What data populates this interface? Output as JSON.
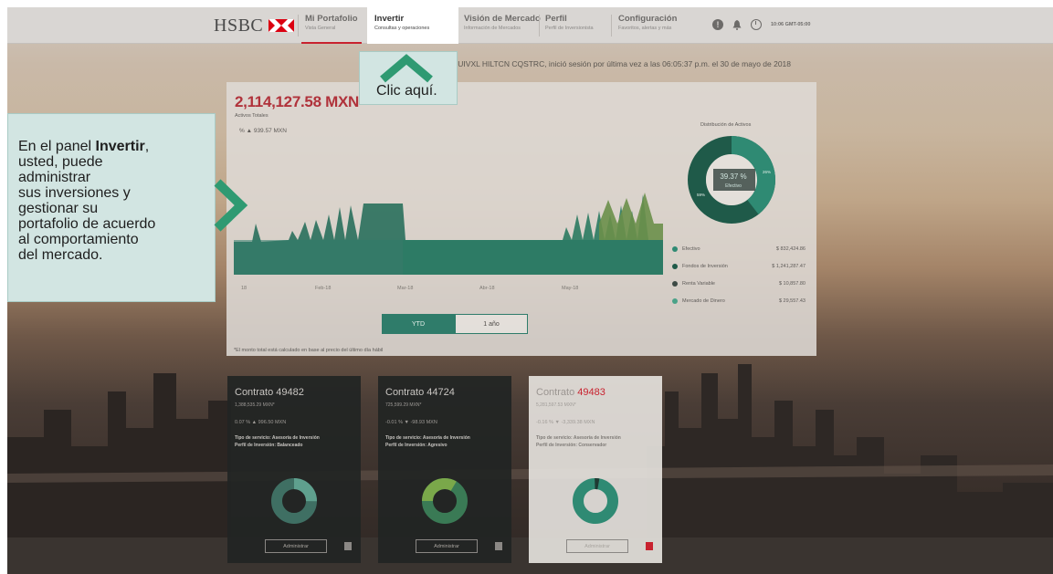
{
  "brand": "HSBC",
  "nav": [
    {
      "title": "Mi Portafolio",
      "sub": "Vista General"
    },
    {
      "title": "Invertir",
      "sub": "Consultas y operaciones"
    },
    {
      "title": "Visión de Mercado",
      "sub": "Información de Mercados"
    },
    {
      "title": "Perfil",
      "sub": "Perfil de Inversionista"
    },
    {
      "title": "Configuración",
      "sub": "Favoritos, alertas y más"
    }
  ],
  "header": {
    "info_icon": "!",
    "time": "10:06 GMT-05:00"
  },
  "session": "SQUIVXL HILTCN CQSTRC, inició sesión por última vez a las 06:05:37 p.m. el 30 de mayo de 2018",
  "summary": {
    "total": "2,114,127.58 MXN",
    "total_label": "Activos Totales",
    "change": "% ▲ 939.57 MXN",
    "months": [
      "Feb-18",
      "Mar-18",
      "Abr-18",
      "May-18"
    ],
    "month_first": "18",
    "tabs": [
      "YTD",
      "1 año"
    ],
    "note": "*El monto total está calculado en base al precio del último día hábil"
  },
  "distribution": {
    "title": "Distribución de Activos",
    "center_pct": "39.37 %",
    "center_label": "Efectivo",
    "label_right": "26%",
    "label_left": "59%",
    "legend": [
      {
        "name": "Efectivo",
        "value": "$ 832,424.86",
        "color": "#2f8a73"
      },
      {
        "name": "Fondos de Inversión",
        "value": "$ 1,241,287.47",
        "color": "#1f5a49"
      },
      {
        "name": "Renta Variable",
        "value": "$ 10,857.80",
        "color": "#3d4a45"
      },
      {
        "name": "Mercado de Dinero",
        "value": "$ 29,557.43",
        "color": "#4aa288"
      }
    ]
  },
  "contracts": [
    {
      "title": "Contrato 49482",
      "value": "1,388,535.29 MXN*",
      "change": "0.07 % ▲ 996.50 MXN",
      "service": "Tipo de servicio: Asesoría de Inversión",
      "profile": "Perfil de Inversión: Balanceado",
      "button": "Administrar"
    },
    {
      "title": "Contrato 44724",
      "value": "725,599.29 MXN*",
      "change": "-0.01 % ▼ -98.93 MXN",
      "service": "Tipo de servicio: Asesoría de Inversión",
      "profile": "Perfil de Inversión: Agresivo",
      "button": "Administrar"
    },
    {
      "title_prefix": "Contrato ",
      "title_num": "49483",
      "value": "5,281,597.53 MXN*",
      "change": "-0.16 % ▼ -3,339.38 MXN",
      "service": "Tipo de servicio: Asesoría de Inversión",
      "profile": "Perfil de Inversión: Conservador",
      "button": "Administrar"
    }
  ],
  "tooltip_left": {
    "pre": "En el panel ",
    "bold": "Invertir",
    "post": ",",
    "lines": [
      "usted, puede",
      "administrar",
      "sus inversiones y",
      "gestionar su",
      "portafolio de acuerdo",
      "al comportamiento",
      "del mercado."
    ]
  },
  "tooltip_top": "Clic aquí.",
  "colors": {
    "accent_green": "#2f7c6a",
    "brand_red": "#c8222f",
    "tooltip_bg": "#d2e5e2"
  }
}
